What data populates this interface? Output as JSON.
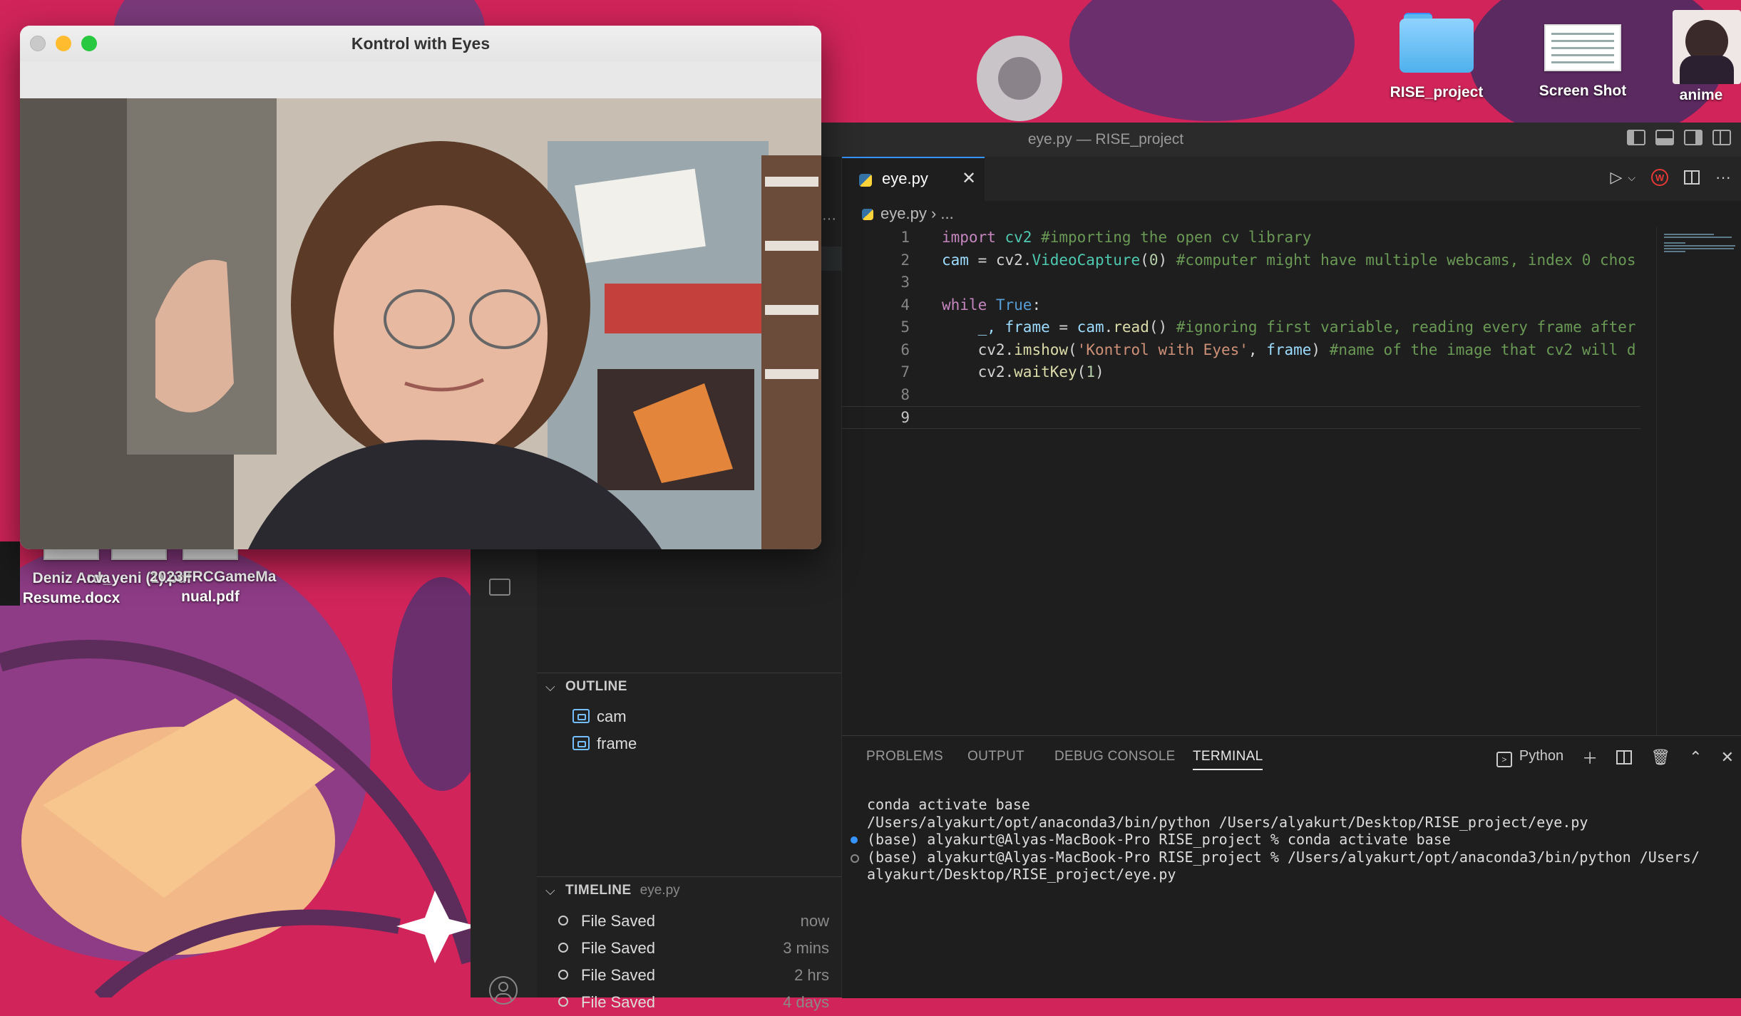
{
  "desktop": {
    "icons_top": [
      {
        "label": "RISE_project"
      },
      {
        "label": "Screen Shot"
      },
      {
        "label": "anime"
      }
    ],
    "icons_left": [
      {
        "label_line1": "Deniz Arda",
        "label_line2": "Resume.docx"
      },
      {
        "label_line1": "cv_yeni (1).pdf",
        "label_line2": ""
      },
      {
        "label_line1": "2023FRCGameMa",
        "label_line2": "nual.pdf"
      }
    ]
  },
  "cv_window": {
    "title": "Kontrol with Eyes"
  },
  "vscode": {
    "title": "eye.py — RISE_project",
    "tab": {
      "name": "eye.py",
      "close": "✕"
    },
    "breadcrumb": {
      "file": "eye.py",
      "sep": "›",
      "rest": "..."
    },
    "code_lines": [
      {
        "n": "1",
        "html_key": "l1"
      },
      {
        "n": "2",
        "html_key": "l2"
      },
      {
        "n": "3",
        "html_key": "l3"
      },
      {
        "n": "4",
        "html_key": "l4"
      },
      {
        "n": "5",
        "html_key": "l5"
      },
      {
        "n": "6",
        "html_key": "l6"
      },
      {
        "n": "7",
        "html_key": "l7"
      },
      {
        "n": "8",
        "html_key": "l8"
      },
      {
        "n": "9",
        "html_key": "l9"
      }
    ],
    "code_text": {
      "l1a": "import",
      "l1b": " cv2 ",
      "l1c": "#importing the open cv library",
      "l2a": "cam",
      "l2b": " = cv2.",
      "l2c": "VideoCapture",
      "l2d": "(",
      "l2e": "0",
      "l2f": ") ",
      "l2g": "#computer might have multiple webcams, index 0 chos",
      "l4a": "while",
      "l4b": " True",
      "l4c": ":",
      "l5a": "    _, ",
      "l5b": "frame",
      "l5c": " = ",
      "l5d": "cam",
      "l5e": ".",
      "l5f": "read",
      "l5g": "() ",
      "l5h": "#ignoring first variable, reading every frame after",
      "l6a": "    cv2.",
      "l6b": "imshow",
      "l6c": "(",
      "l6d": "'Kontrol with Eyes'",
      "l6e": ", ",
      "l6f": "frame",
      "l6g": ") ",
      "l6h": "#name of the image that cv2 will d",
      "l7a": "    cv2.",
      "l7b": "waitKey",
      "l7c": "(",
      "l7d": "1",
      "l7e": ")"
    },
    "outline": {
      "title": "OUTLINE",
      "items": [
        "cam",
        "frame"
      ]
    },
    "timeline": {
      "title": "TIMELINE",
      "file": "eye.py",
      "items": [
        {
          "label": "File Saved",
          "time": "now"
        },
        {
          "label": "File Saved",
          "time": "3 mins"
        },
        {
          "label": "File Saved",
          "time": "2 hrs"
        },
        {
          "label": "File Saved",
          "time": "4 days"
        }
      ]
    },
    "panel": {
      "tabs": [
        "PROBLEMS",
        "OUTPUT",
        "DEBUG CONSOLE",
        "TERMINAL"
      ],
      "active_tab": "TERMINAL",
      "terminal_name": "Python",
      "terminal_lines": [
        "conda activate base",
        "/Users/alyakurt/opt/anaconda3/bin/python /Users/alyakurt/Desktop/RISE_project/eye.py",
        "(base) alyakurt@Alyas-MacBook-Pro RISE_project % conda activate base",
        "(base) alyakurt@Alyas-MacBook-Pro RISE_project % /Users/alyakurt/opt/anaconda3/bin/python /Users/",
        "alyakurt/Desktop/RISE_project/eye.py"
      ]
    }
  },
  "colors": {
    "wallpaper_pink": "#d0245a",
    "vscode_bg": "#1e1e1e",
    "accent_blue": "#3794ff",
    "traffic_red": "#ff5f57",
    "traffic_yellow": "#febc2e",
    "traffic_green": "#28c840"
  }
}
